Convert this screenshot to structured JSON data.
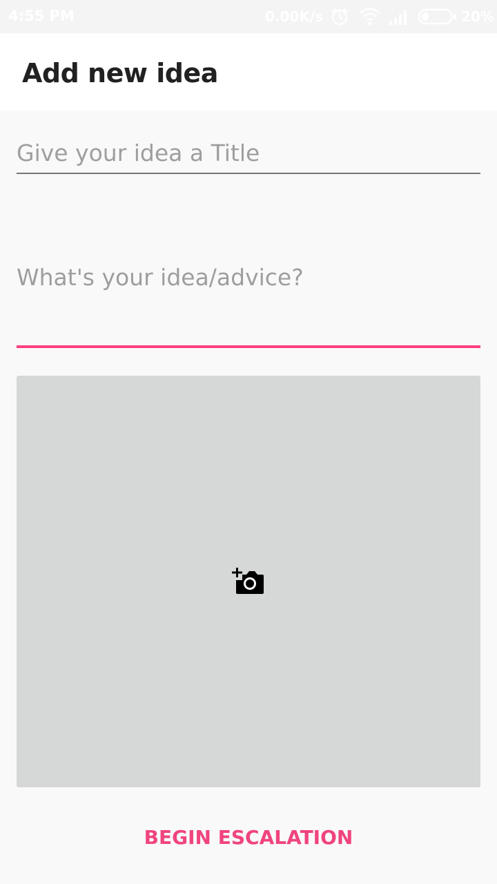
{
  "status_bar": {
    "time": "4:55 PM",
    "network_speed": "0.00K/s",
    "battery_percent": "20%",
    "icons": [
      "alarm-icon",
      "wifi-icon",
      "signal-icon",
      "battery-icon"
    ]
  },
  "app_bar": {
    "title": "Add new idea"
  },
  "form": {
    "title_placeholder": "Give your idea a Title",
    "idea_placeholder": "What's your idea/advice?",
    "photo_icon": "add-a-photo-icon"
  },
  "actions": {
    "submit_label": "BEGIN ESCALATION"
  },
  "colors": {
    "accent": "#ff4081",
    "status_text": "#ffffff",
    "photo_bg": "#d6d7d7",
    "hint_text": "#9e9e9e"
  }
}
